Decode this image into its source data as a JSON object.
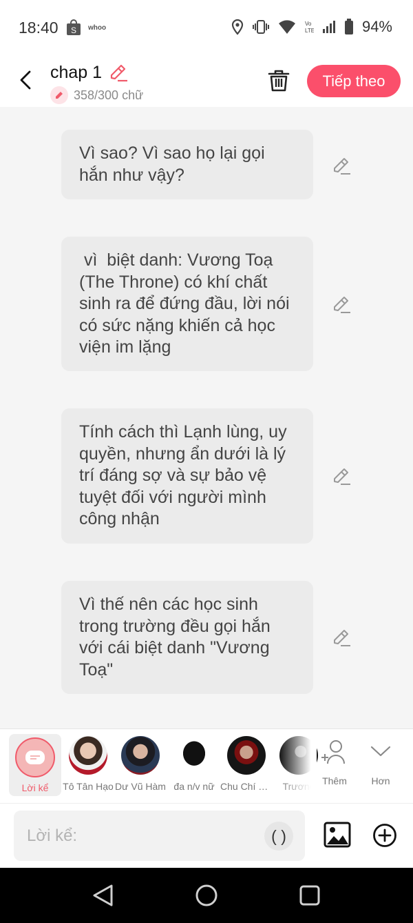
{
  "status_bar": {
    "time": "18:40",
    "shop_icon": "shopping-bag-icon",
    "app_label": "whoo",
    "battery": "94%"
  },
  "header": {
    "title": "chap 1",
    "count": "358/300 chữ",
    "next_label": "Tiếp theo",
    "accent_color": "#fb4f6b"
  },
  "messages": [
    {
      "text": "Vì sao? Vì sao họ lại gọi hắn như vậy?"
    },
    {
      "text": " vì  biệt danh: Vương Toạ (The Throne) có khí chất sinh ra để đứng đầu, lời nói có sức nặng khiến cả học viện im lặng"
    },
    {
      "text": "Tính cách thì Lạnh lùng, uy quyền, nhưng ẩn dưới là lý trí đáng sợ và sự bảo vệ tuyệt đối với người mình công nhận"
    },
    {
      "text": "Vì thế nên các học sinh trong trường đều gọi hắn với cái biệt danh \"Vương Toạ\""
    }
  ],
  "characters": {
    "narrator": "Lời kể",
    "items": [
      {
        "label": "Tô Tân Hạo"
      },
      {
        "label": "Dư Vũ Hàm"
      },
      {
        "label": "đa n/v nữ"
      },
      {
        "label": "Chu Chí Hâm"
      },
      {
        "label": "Trương"
      }
    ],
    "add_label": "Thêm",
    "more_label": "Hơn"
  },
  "input": {
    "placeholder": "Lời kể:",
    "paren_label": "( )"
  }
}
